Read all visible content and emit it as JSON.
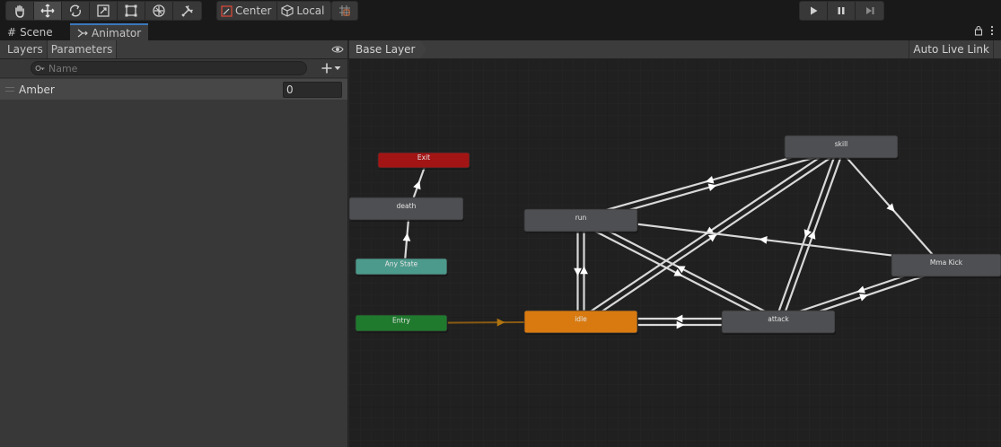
{
  "toolbar": {
    "tools": [
      "hand-icon",
      "move-icon",
      "rotate-icon",
      "scale-icon",
      "rect-icon",
      "transform-icon",
      "custom-tool-icon"
    ],
    "pivot_label": "Center",
    "space_label": "Local",
    "snap_icon": "grid-snap-icon",
    "play_icons": [
      "play-icon",
      "pause-icon",
      "step-icon"
    ]
  },
  "tabs": {
    "scene_label": "Scene",
    "animator_label": "Animator"
  },
  "left_panel": {
    "layers_tab": "Layers",
    "parameters_tab": "Parameters",
    "search_placeholder": "Name",
    "parameters": [
      {
        "name": "Amber",
        "value": "0"
      }
    ]
  },
  "graph_header": {
    "breadcrumb": "Base Layer",
    "auto_live_link": "Auto Live Link"
  },
  "graph": {
    "colors": {
      "background": "#202020",
      "grid_minor": "#262626",
      "grid_major": "#1a1a1a",
      "state": "#4e4f52",
      "exit": "#a31515",
      "any_state": "#4c9a8c",
      "entry": "#1f7a2e",
      "default_state": "#d97a10",
      "transition": "#d8d8d8",
      "default_transition": "#8a5a12"
    },
    "states": [
      {
        "id": "exit",
        "label": "Exit",
        "kind": "exit"
      },
      {
        "id": "death",
        "label": "death",
        "kind": "state"
      },
      {
        "id": "any",
        "label": "Any State",
        "kind": "any"
      },
      {
        "id": "entry",
        "label": "Entry",
        "kind": "entry"
      },
      {
        "id": "run",
        "label": "run",
        "kind": "state"
      },
      {
        "id": "idle",
        "label": "idle",
        "kind": "default"
      },
      {
        "id": "attack",
        "label": "attack",
        "kind": "state"
      },
      {
        "id": "skill",
        "label": "skill",
        "kind": "state"
      },
      {
        "id": "mma",
        "label": "Mma Kick",
        "kind": "state"
      }
    ],
    "transitions": [
      {
        "from": "death",
        "to": "exit"
      },
      {
        "from": "any",
        "to": "death"
      },
      {
        "from": "entry",
        "to": "idle",
        "default": true
      },
      {
        "from": "idle",
        "to": "run"
      },
      {
        "from": "run",
        "to": "idle"
      },
      {
        "from": "idle",
        "to": "attack"
      },
      {
        "from": "attack",
        "to": "idle"
      },
      {
        "from": "run",
        "to": "attack"
      },
      {
        "from": "attack",
        "to": "run"
      },
      {
        "from": "run",
        "to": "skill"
      },
      {
        "from": "skill",
        "to": "run"
      },
      {
        "from": "idle",
        "to": "skill"
      },
      {
        "from": "skill",
        "to": "idle"
      },
      {
        "from": "attack",
        "to": "skill"
      },
      {
        "from": "skill",
        "to": "attack"
      },
      {
        "from": "skill",
        "to": "mma"
      },
      {
        "from": "mma",
        "to": "run"
      },
      {
        "from": "attack",
        "to": "mma"
      },
      {
        "from": "mma",
        "to": "attack"
      }
    ]
  }
}
